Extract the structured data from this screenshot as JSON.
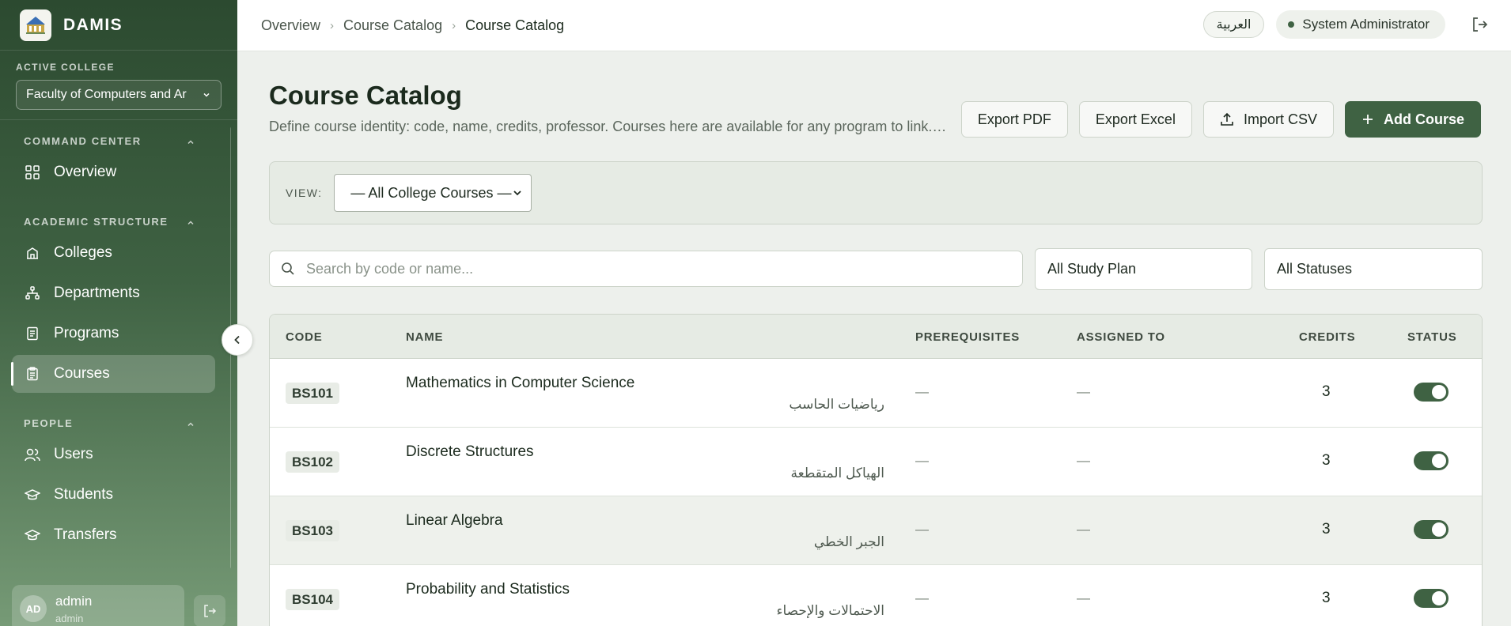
{
  "app": {
    "name": "DAMIS"
  },
  "sidebar": {
    "active_college_label": "ACTIVE COLLEGE",
    "active_college_value": "Faculty of Computers and Ar",
    "sections": [
      {
        "title": "COMMAND CENTER",
        "items": [
          {
            "label": "Overview",
            "icon": "grid-icon"
          }
        ]
      },
      {
        "title": "ACADEMIC STRUCTURE",
        "items": [
          {
            "label": "Colleges",
            "icon": "building-icon"
          },
          {
            "label": "Departments",
            "icon": "hierarchy-icon"
          },
          {
            "label": "Programs",
            "icon": "book-icon"
          },
          {
            "label": "Courses",
            "icon": "clipboard-icon",
            "active": true
          }
        ]
      },
      {
        "title": "PEOPLE",
        "items": [
          {
            "label": "Users",
            "icon": "users-icon"
          },
          {
            "label": "Students",
            "icon": "graduation-cap-icon"
          },
          {
            "label": "Transfers",
            "icon": "graduation-cap-icon"
          }
        ]
      }
    ],
    "user": {
      "initials": "AD",
      "name": "admin",
      "role": "admin"
    }
  },
  "topbar": {
    "breadcrumbs": [
      "Overview",
      "Course Catalog",
      "Course Catalog"
    ],
    "language_button": "العربية",
    "user_label": "System Administrator"
  },
  "page": {
    "title": "Course Catalog",
    "subtitle": "Define course identity: code, name, credits, professor. Courses here are available for any program to link.  1...",
    "actions": {
      "export_pdf": "Export PDF",
      "export_excel": "Export Excel",
      "import_csv": "Import CSV",
      "add_course": "Add Course"
    },
    "view_label": "VIEW:",
    "view_value": "— All College Courses —",
    "search_placeholder": "Search by code or name...",
    "study_plan_filter": "All Study Plan",
    "status_filter": "All Statuses"
  },
  "table": {
    "headers": {
      "code": "CODE",
      "name": "NAME",
      "prerequisites": "PREREQUISITES",
      "assigned_to": "ASSIGNED TO",
      "credits": "CREDITS",
      "status": "STATUS"
    },
    "rows": [
      {
        "code": "BS101",
        "name_en": "Mathematics in Computer Science",
        "name_ar": "رياضيات الحاسب",
        "prerequisites": "—",
        "assigned_to": "—",
        "credits": "3",
        "active": true
      },
      {
        "code": "BS102",
        "name_en": "Discrete Structures",
        "name_ar": "الهياكل المتقطعة",
        "prerequisites": "—",
        "assigned_to": "—",
        "credits": "3",
        "active": true
      },
      {
        "code": "BS103",
        "name_en": "Linear Algebra",
        "name_ar": "الجبر الخطي",
        "prerequisites": "—",
        "assigned_to": "—",
        "credits": "3",
        "active": true
      },
      {
        "code": "BS104",
        "name_en": "Probability and Statistics",
        "name_ar": "الاحتمالات والإحصاء",
        "prerequisites": "—",
        "assigned_to": "—",
        "credits": "3",
        "active": true
      }
    ]
  },
  "colors": {
    "brand": "#3f6243",
    "sidebar_top": "#2c4a30",
    "sidebar_bottom": "#769a76"
  }
}
